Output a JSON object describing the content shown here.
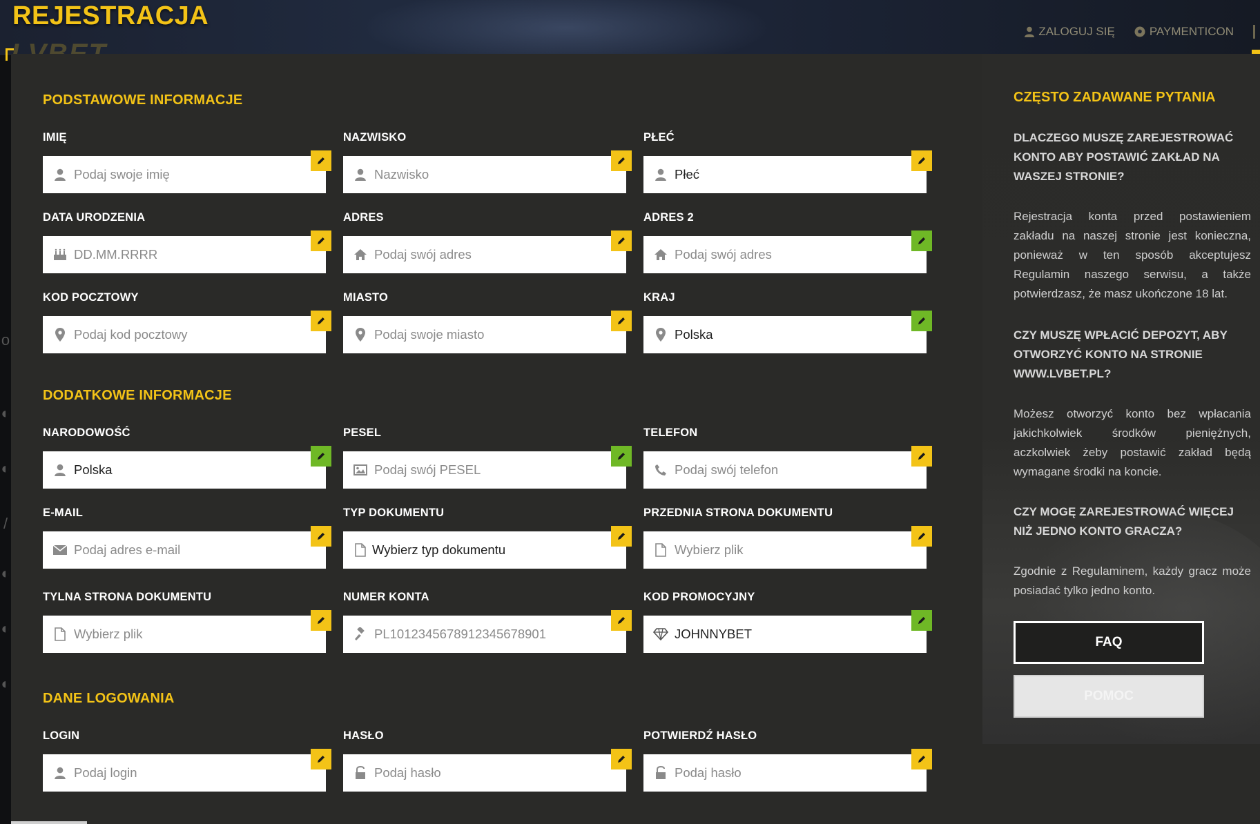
{
  "header": {
    "title": "REJESTRACJA",
    "logo_text": "LVBET",
    "links": [
      {
        "label": "ZALOGUJ SIĘ",
        "icon": "user-icon"
      },
      {
        "label": "PAYMENTICON",
        "icon": "soccer-ball-icon"
      }
    ]
  },
  "colors": {
    "accent": "#f3c317",
    "panel": "#2a2a28",
    "edit_pending": "#f3c317",
    "edit_ok": "#6fb826"
  },
  "sections": {
    "basic": "PODSTAWOWE INFORMACJE",
    "additional": "DODATKOWE INFORMACJE",
    "login": "DANE LOGOWANIA"
  },
  "fields": {
    "first_name": {
      "label": "IMIĘ",
      "placeholder": "Podaj swoje imię",
      "value": "",
      "icon": "user-icon",
      "status": "pending"
    },
    "last_name": {
      "label": "NAZWISKO",
      "placeholder": "Nazwisko",
      "value": "",
      "icon": "user-icon",
      "status": "pending"
    },
    "gender": {
      "label": "PŁEĆ",
      "placeholder": "",
      "value": "Płeć",
      "icon": "user-icon",
      "status": "pending"
    },
    "birth_date": {
      "label": "DATA URODZENIA",
      "placeholder": "DD.MM.RRRR",
      "value": "",
      "icon": "birthday-cake-icon",
      "status": "pending"
    },
    "address": {
      "label": "ADRES",
      "placeholder": "Podaj swój adres",
      "value": "",
      "icon": "home-icon",
      "status": "pending"
    },
    "address2": {
      "label": "ADRES 2",
      "placeholder": "Podaj swój adres",
      "value": "",
      "icon": "home-icon",
      "status": "ok"
    },
    "postal_code": {
      "label": "KOD POCZTOWY",
      "placeholder": "Podaj kod pocztowy",
      "value": "",
      "icon": "map-marker-icon",
      "status": "pending"
    },
    "city": {
      "label": "MIASTO",
      "placeholder": "Podaj swoje miasto",
      "value": "",
      "icon": "map-marker-icon",
      "status": "pending"
    },
    "country": {
      "label": "KRAJ",
      "placeholder": "",
      "value": "Polska",
      "icon": "map-marker-icon",
      "status": "ok"
    },
    "nationality": {
      "label": "NARODOWOŚĆ",
      "placeholder": "",
      "value": "Polska",
      "icon": "user-icon",
      "status": "ok"
    },
    "pesel": {
      "label": "PESEL",
      "placeholder": "Podaj swój PESEL",
      "value": "",
      "icon": "picture-icon",
      "status": "ok"
    },
    "phone": {
      "label": "TELEFON",
      "placeholder": "Podaj swój telefon",
      "value": "",
      "icon": "phone-icon",
      "status": "pending"
    },
    "email": {
      "label": "E-MAIL",
      "placeholder": "Podaj adres  e-mail",
      "value": "",
      "icon": "envelope-icon",
      "status": "pending"
    },
    "doc_type": {
      "label": "TYP DOKUMENTU",
      "placeholder": "",
      "value": "Wybierz typ dokumentu",
      "icon": "file-icon",
      "status": "pending"
    },
    "doc_front": {
      "label": "PRZEDNIA STRONA DOKUMENTU",
      "placeholder": "Wybierz plik",
      "value": "",
      "icon": "file-icon",
      "status": "pending"
    },
    "doc_back": {
      "label": "TYLNA STRONA DOKUMENTU",
      "placeholder": "Wybierz plik",
      "value": "",
      "icon": "file-icon",
      "status": "pending"
    },
    "account_number": {
      "label": "NUMER KONTA",
      "placeholder": "PL10123456789123456789​01",
      "value": "",
      "icon": "gavel-icon",
      "status": "pending"
    },
    "promo_code": {
      "label": "KOD PROMOCYJNY",
      "placeholder": "",
      "value": "JOHNNYBET",
      "icon": "diamond-icon",
      "status": "ok"
    },
    "login": {
      "label": "LOGIN",
      "placeholder": "Podaj login",
      "value": "",
      "icon": "user-icon",
      "status": "pending"
    },
    "password": {
      "label": "HASŁO",
      "placeholder": "Podaj hasło",
      "value": "",
      "icon": "lock-icon",
      "status": "pending"
    },
    "password_confirm": {
      "label": "POTWIERDŹ HASŁO",
      "placeholder": "Podaj hasło",
      "value": "",
      "icon": "lock-icon",
      "status": "pending"
    }
  },
  "faq": {
    "title": "CZĘSTO ZADAWANE PYTANIA",
    "items": [
      {
        "q": "DLACZEGO MUSZĘ ZAREJESTROWAĆ KONTO ABY POSTAWIĆ ZAKŁAD NA WASZEJ STRONIE?",
        "a": "Rejestracja konta przed postawieniem zakładu na naszej stronie jest konieczna, ponieważ w ten sposób akceptujesz Regulamin naszego serwisu, a także potwierdzasz, że masz ukończone 18 lat."
      },
      {
        "q": "CZY MUSZĘ WPŁACIĆ DEPOZYT, ABY OTWORZYĆ KONTO NA STRONIE WWW.LVBET.PL?",
        "a": "Możesz otworzyć konto bez wpłacania jakichkolwiek środków pieniężnych, aczkolwiek żeby postawić zakład będą wymagane środki na koncie."
      },
      {
        "q": "CZY MOGĘ ZAREJESTROWAĆ WIĘCEJ NIŻ JEDNO KONTO GRACZA?",
        "a": "Zgodnie z Regulaminem, każdy gracz może posiadać tylko jedno konto."
      }
    ],
    "buttons": {
      "faq": "FAQ",
      "help": "POMOC"
    }
  }
}
